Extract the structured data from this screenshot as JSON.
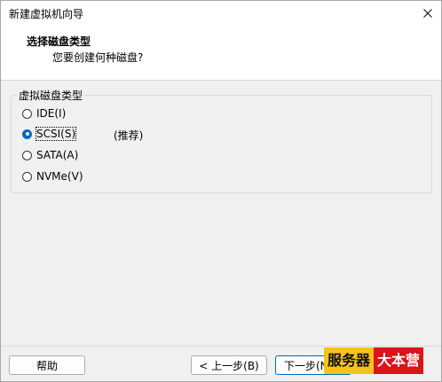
{
  "window": {
    "title": "新建虚拟机向导"
  },
  "header": {
    "title": "选择磁盘类型",
    "subtitle": "您要创建何种磁盘?"
  },
  "disk_type_group": {
    "legend": "虚拟磁盘类型",
    "options": [
      {
        "label": "IDE(I)",
        "checked": false
      },
      {
        "label": "SCSI(S)",
        "checked": true
      },
      {
        "label": "SATA(A)",
        "checked": false
      },
      {
        "label": "NVMe(V)",
        "checked": false
      }
    ],
    "recommended_note": "(推荐)"
  },
  "buttons": {
    "help": "帮助",
    "back": "< 上一步(B)",
    "next": "下一步(N"
  },
  "watermark": {
    "part1": "服务器",
    "part2": "大本营"
  },
  "colors": {
    "accent": "#0067c0",
    "watermark_yellow": "#f6c21c",
    "watermark_red": "#d9141b"
  }
}
